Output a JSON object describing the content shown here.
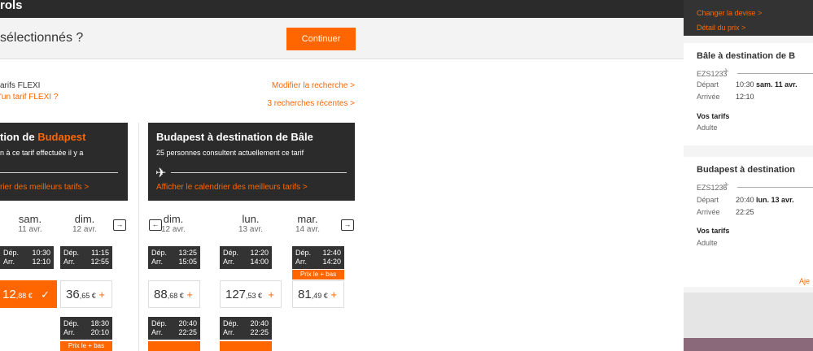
{
  "header": {
    "title": "rols"
  },
  "question": {
    "text": "sélectionnés ?",
    "continue_label": "Continuer"
  },
  "search": {
    "flexi_line1": "arifs FLEXI",
    "flexi_line2": "'un tarif FLEXI ?",
    "modify_label": "Modifier la recherche >",
    "recent_label": "3 recherches récentes >"
  },
  "outbound": {
    "title_prefix": "tion de ",
    "title_city": "Budapest",
    "subtitle": "n à ce tarif effectuée il y a",
    "calendar_link": "rier des meilleurs tarifs >"
  },
  "inbound": {
    "title": "Budapest à destination de Bâle",
    "subtitle": "25 personnes consultent actuellement ce tarif",
    "calendar_link": "Afficher le calendrier des meilleurs tarifs >",
    "plane_icon": "airplane-icon"
  },
  "days_out": [
    {
      "day": "sam.",
      "date": "11 avr."
    },
    {
      "day": "dim.",
      "date": "12 avr."
    }
  ],
  "days_in": [
    {
      "day": "dim.",
      "date": "12 avr."
    },
    {
      "day": "lun.",
      "date": "13 avr."
    },
    {
      "day": "mar.",
      "date": "14 avr."
    }
  ],
  "labels": {
    "dep": "Dép.",
    "arr": "Arr.",
    "lowest": "Prix le + bas"
  },
  "flights_out": [
    {
      "dep": "10:30",
      "arr": "12:10"
    },
    {
      "dep": "11:15",
      "arr": "12:55"
    },
    {
      "dep": "18:30",
      "arr": "20:10"
    }
  ],
  "flights_in": [
    {
      "dep": "13:25",
      "arr": "15:05"
    },
    {
      "dep": "12:20",
      "arr": "14:00"
    },
    {
      "dep": "12:40",
      "arr": "14:20"
    },
    {
      "dep": "20:40",
      "arr": "22:25"
    },
    {
      "dep": "20:40",
      "arr": "22:25"
    }
  ],
  "prices_out": [
    {
      "main": "12",
      "cents": ",88 €",
      "mark": "✓"
    },
    {
      "main": "36",
      "cents": ",65 €",
      "mark": "+"
    }
  ],
  "prices_in": [
    {
      "main": "88",
      "cents": ",68 €",
      "mark": "+"
    },
    {
      "main": "127",
      "cents": ",53 €",
      "mark": "+"
    },
    {
      "main": "81",
      "cents": ",49 €",
      "mark": "+"
    }
  ],
  "summary": {
    "change_currency": "Changer la devise >",
    "price_detail": "Détail du prix >",
    "leg1": {
      "title": "Bâle à destination de B",
      "code": "EZS1233",
      "dep_label": "Départ",
      "dep_time": "10:30",
      "dep_date": "sam. 11 avr.",
      "arr_label": "Arrivée",
      "arr_time": "12:10",
      "fares_label": "Vos tarifs",
      "pax": "Adulte"
    },
    "leg2": {
      "title": "Budapest à destination",
      "code": "EZS1236",
      "dep_label": "Départ",
      "dep_time": "20:40",
      "dep_date": "lun. 13 avr.",
      "arr_label": "Arrivée",
      "arr_time": "22:25",
      "fares_label": "Vos tarifs",
      "pax": "Adulte"
    },
    "add_label": "Aje"
  },
  "colors": {
    "accent": "#ff6600",
    "dark": "#2b2b2b"
  }
}
